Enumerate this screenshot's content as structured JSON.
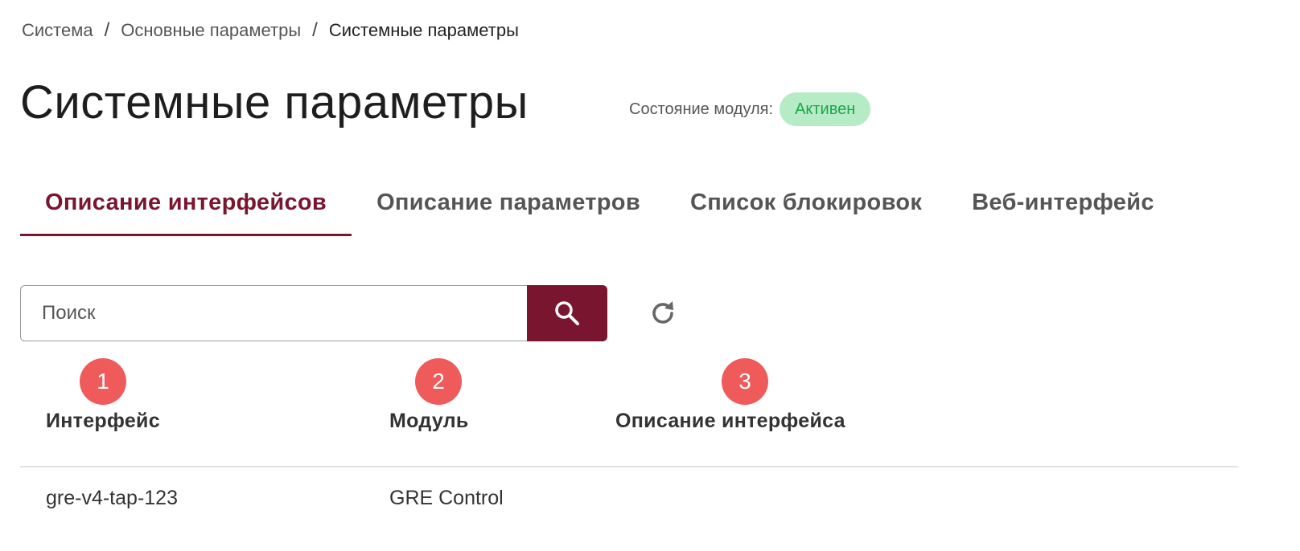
{
  "breadcrumb": {
    "items": [
      "Система",
      "Основные параметры",
      "Системные параметры"
    ],
    "separator": "/"
  },
  "page": {
    "title": "Системные параметры",
    "status_label": "Состояние модуля:",
    "status_value": "Активен"
  },
  "tabs": [
    {
      "label": "Описание интерфейсов",
      "active": true
    },
    {
      "label": "Описание параметров",
      "active": false
    },
    {
      "label": "Список блокировок",
      "active": false
    },
    {
      "label": "Веб-интерфейс",
      "active": false
    }
  ],
  "search": {
    "placeholder": "Поиск",
    "value": ""
  },
  "markers": [
    "1",
    "2",
    "3"
  ],
  "table": {
    "columns": [
      "Интерфейс",
      "Модуль",
      "Описание интерфейса"
    ],
    "rows": [
      [
        "gre-v4-tap-123",
        "GRE Control",
        ""
      ]
    ]
  },
  "icons": {
    "search": "search-icon",
    "refresh": "refresh-icon"
  },
  "colors": {
    "accent": "#7a1530",
    "status_bg": "#b6ecc5",
    "status_text": "#1ea54a",
    "marker": "#ef5b5b"
  }
}
